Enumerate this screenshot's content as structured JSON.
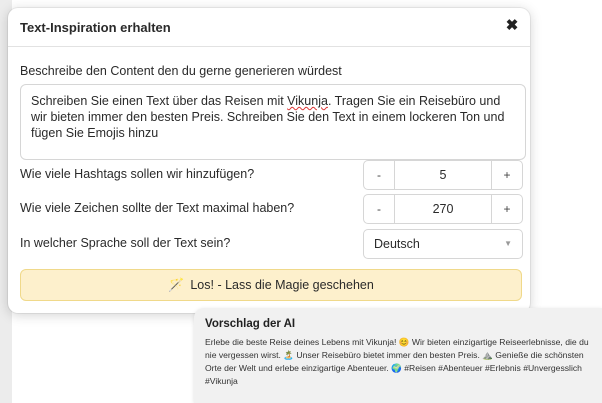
{
  "dialog": {
    "title": "Text-Inspiration erhalten",
    "close_glyph": "✖",
    "content_label": "Beschreibe den Content den du gerne generieren würdest",
    "content_value_pre": "Schreiben Sie einen Text über das Reisen mit ",
    "content_value_misspelled": "Vikunja",
    "content_value_post": ". Tragen Sie ein Reisebüro und wir bieten immer den besten Preis. Schreiben Sie den Text in einem lockeren Ton und fügen Sie Emojis hinzu",
    "hashtags": {
      "label": "Wie viele Hashtags sollen wir hinzufügen?",
      "minus": "-",
      "value": "5",
      "plus": "+"
    },
    "max_chars": {
      "label": "Wie viele Zeichen sollte der Text maximal haben?",
      "minus": "-",
      "value": "270",
      "plus": "+"
    },
    "language": {
      "label": "In welcher Sprache soll der Text sein?",
      "value": "Deutsch",
      "chevron_icon": "chevron-down-icon"
    },
    "magic_button": {
      "icon": "magic-wand-icon",
      "label": "Los! - Lass die Magie geschehen"
    }
  },
  "suggestion": {
    "title": "Vorschlag der AI",
    "text": "Erlebe die beste Reise deines Lebens mit Vikunja! 😊 Wir bieten einzigartige Reiseerlebnisse, die du nie vergessen wirst. 🏝️ Unser Reisebüro bietet immer den besten Preis. ⛰️ Genieße die schönsten Orte der Welt und erlebe einzigartige Abenteuer. 🌍 #Reisen #Abenteuer #Erlebnis #Unvergesslich #Vikunja"
  }
}
